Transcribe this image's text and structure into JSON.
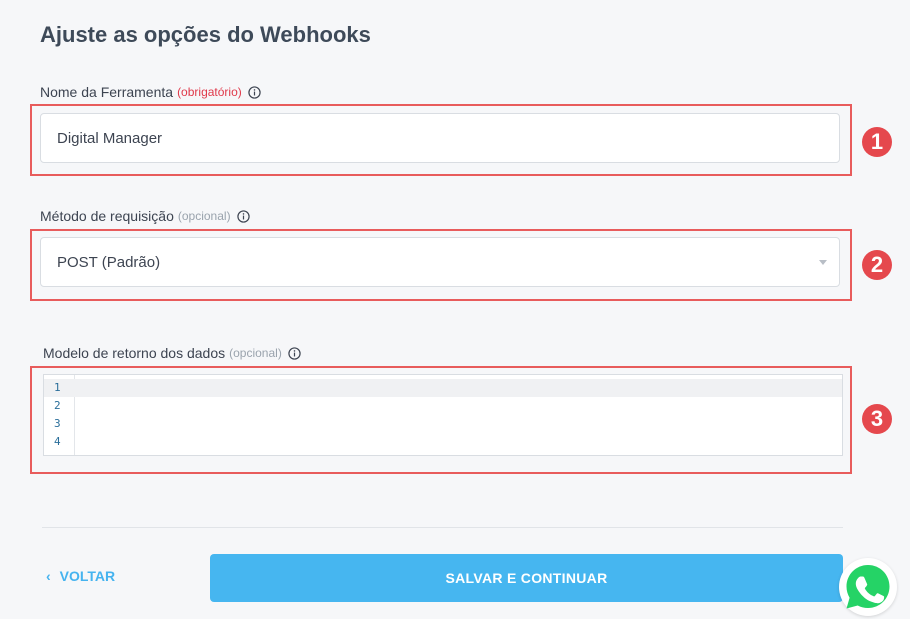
{
  "page": {
    "title": "Ajuste as opções do Webhooks"
  },
  "tool_name": {
    "label": "Nome da Ferramenta",
    "tag": "(obrigatório)",
    "value": "Digital Manager",
    "badge": "1"
  },
  "request_method": {
    "label": "Método de requisição",
    "tag": "(opcional)",
    "selected": "POST (Padrão)",
    "badge": "2"
  },
  "data_model": {
    "label": "Modelo de retorno dos dados",
    "tag": "(opcional)",
    "line_numbers": [
      "1",
      "2",
      "3",
      "4"
    ],
    "badge": "3"
  },
  "footer": {
    "back_label": "VOLTAR",
    "save_label": "SALVAR E CONTINUAR"
  },
  "colors": {
    "accent": "#46b6f0",
    "required": "#e0394a",
    "highlight": "#e85c5c",
    "whatsapp": "#25d366"
  },
  "icons": {
    "info": "info-icon",
    "back": "chevron-left-icon",
    "dropdown": "caret-down-icon",
    "chat": "whatsapp-icon"
  }
}
